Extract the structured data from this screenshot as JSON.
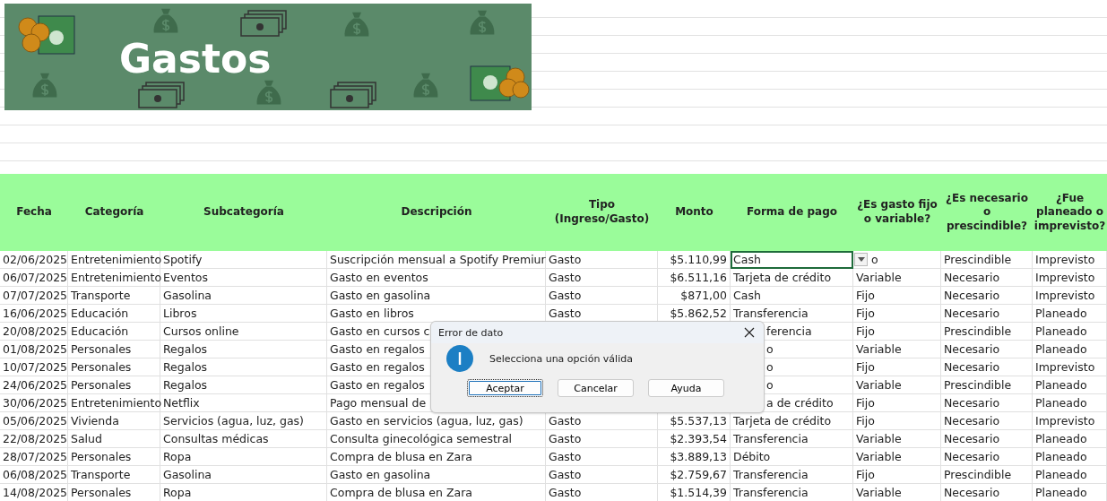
{
  "banner": {
    "title": "Gastos"
  },
  "columns": [
    "Fecha",
    "Categoría",
    "Subcategoría",
    "Descripción",
    "Tipo (Ingreso/Gasto)",
    "Monto",
    "Forma de pago",
    "¿Es gasto fijo o variable?",
    "¿Es necesario o prescindible?",
    "¿Fue planeado o imprevisto?"
  ],
  "rows": [
    {
      "cells": [
        "02/06/2025",
        "Entretenimiento",
        "Spotify",
        "Suscripción mensual a Spotify Premiur",
        "Gasto",
        "$5.110,99",
        {
          "text": "Cash",
          "selected": true
        },
        "o",
        "Prescindible",
        "Imprevisto"
      ]
    },
    {
      "cells": [
        "06/07/2025",
        "Entretenimiento",
        "Eventos",
        "Gasto en eventos",
        "Gasto",
        "$6.511,16",
        "Tarjeta de crédito",
        "Variable",
        "Necesario",
        "Imprevisto"
      ]
    },
    {
      "cells": [
        "07/07/2025",
        "Transporte",
        "Gasolina",
        "Gasto en gasolina",
        "Gasto",
        "$871,00",
        "Cash",
        "Fijo",
        "Necesario",
        "Imprevisto"
      ]
    },
    {
      "cells": [
        "16/06/2025",
        "Educación",
        "Libros",
        "Gasto en libros",
        "Gasto",
        "$5.862,52",
        "Transferencia",
        "Fijo",
        "Necesario",
        "Planeado"
      ]
    },
    {
      "cells": [
        "20/08/2025",
        "Educación",
        "Cursos online",
        "Gasto en cursos c",
        null,
        null,
        {
          "text": "ferencia",
          "cut_start": true
        },
        "Fijo",
        "Prescindible",
        "Planeado"
      ]
    },
    {
      "cells": [
        "01/08/2025",
        "Personales",
        "Regalos",
        "Gasto en regalos",
        null,
        null,
        {
          "text": "o",
          "cut_start": true
        },
        "Variable",
        "Necesario",
        "Planeado"
      ]
    },
    {
      "cells": [
        "10/07/2025",
        "Personales",
        "Regalos",
        "Gasto en regalos",
        null,
        null,
        {
          "text": "o",
          "cut_start": true
        },
        "Fijo",
        "Necesario",
        "Imprevisto"
      ]
    },
    {
      "cells": [
        "24/06/2025",
        "Personales",
        "Regalos",
        "Gasto en regalos",
        null,
        null,
        {
          "text": "o",
          "cut_start": true
        },
        "Variable",
        "Prescindible",
        "Planeado"
      ]
    },
    {
      "cells": [
        "30/06/2025",
        "Entretenimiento",
        "Netflix",
        "Pago mensual de",
        null,
        null,
        {
          "text": "a de crédito",
          "cut_start": true
        },
        "Fijo",
        "Necesario",
        "Planeado"
      ]
    },
    {
      "cells": [
        "05/06/2025",
        "Vivienda",
        "Servicios (agua, luz, gas)",
        "Gasto en servicios (agua, luz, gas)",
        "Gasto",
        "$5.537,13",
        "Tarjeta de crédito",
        "Fijo",
        "Necesario",
        "Imprevisto"
      ]
    },
    {
      "cells": [
        "22/08/2025",
        "Salud",
        "Consultas médicas",
        "Consulta ginecológica semestral",
        "Gasto",
        "$2.393,54",
        "Transferencia",
        "Variable",
        "Necesario",
        "Planeado"
      ]
    },
    {
      "cells": [
        "28/07/2025",
        "Personales",
        "Ropa",
        "Compra de blusa en Zara",
        "Gasto",
        "$3.889,13",
        "Débito",
        "Variable",
        "Necesario",
        "Planeado"
      ]
    },
    {
      "cells": [
        "06/08/2025",
        "Transporte",
        "Gasolina",
        "Gasto en gasolina",
        "Gasto",
        "$2.759,67",
        "Transferencia",
        "Fijo",
        "Prescindible",
        "Planeado"
      ]
    },
    {
      "cells": [
        "14/08/2025",
        "Personales",
        "Ropa",
        "Compra de blusa en Zara",
        "Gasto",
        "$1.514,39",
        "Transferencia",
        "Variable",
        "Necesario",
        "Planeado"
      ]
    }
  ],
  "dialog": {
    "title": "Error de dato",
    "message": "Selecciona una opción válida",
    "buttons": [
      {
        "label": "Aceptar",
        "focused": true
      },
      {
        "label": "Cancelar",
        "focused": false
      },
      {
        "label": "Ayuda",
        "focused": false
      }
    ]
  }
}
